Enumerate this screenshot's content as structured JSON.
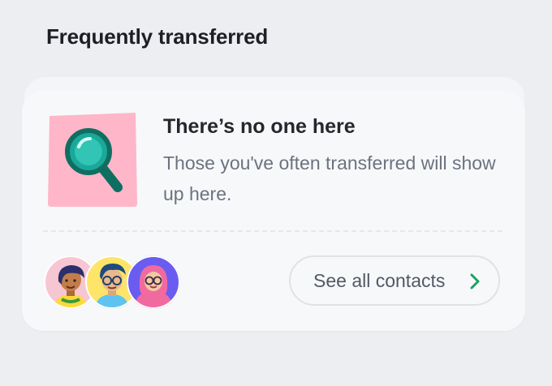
{
  "section": {
    "title": "Frequently transferred"
  },
  "empty_state": {
    "title": "There’s no one here",
    "description": "Those you've often transferred will show up here.",
    "illustration_icon": "magnifier-icon"
  },
  "contacts_button": {
    "label": "See all contacts",
    "icon": "chevron-right-icon"
  },
  "colors": {
    "accent": "#1aa260",
    "illustration_bg": "#ffb6c8",
    "magnifier": "#169c87"
  }
}
